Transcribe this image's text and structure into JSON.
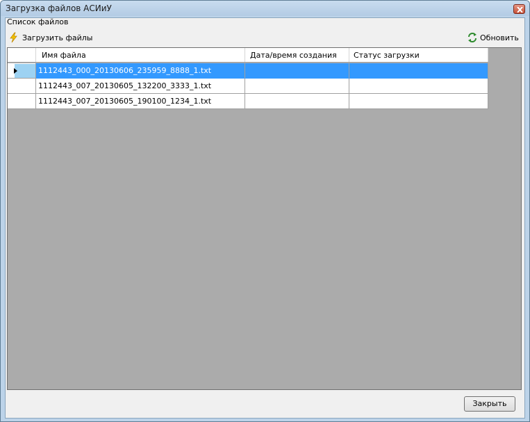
{
  "window": {
    "title": "Загрузка файлов АСИиУ"
  },
  "group": {
    "label": "Список файлов"
  },
  "toolbar": {
    "upload_label": "Загрузить файлы",
    "refresh_label": "Обновить"
  },
  "grid": {
    "columns": [
      "Имя файла",
      "Дата/время создания",
      "Статус загрузки"
    ],
    "rows": [
      {
        "name": "1112443_000_20130606_235959_8888_1.txt",
        "created": "",
        "status": ""
      },
      {
        "name": "1112443_007_20130605_132200_3333_1.txt",
        "created": "",
        "status": ""
      },
      {
        "name": "1112443_007_20130605_190100_1234_1.txt",
        "created": "",
        "status": ""
      }
    ]
  },
  "footer": {
    "close_label": "Закрыть"
  },
  "colors": {
    "selection": "#3399ff",
    "grid_background": "#ababab",
    "window_frame": "#bcd3e9"
  }
}
